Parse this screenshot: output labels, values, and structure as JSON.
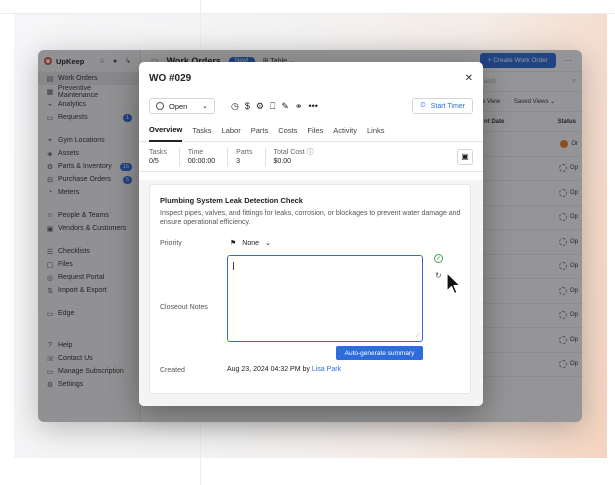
{
  "app": {
    "brand": "UpKeep",
    "sidebar": {
      "items": [
        {
          "label": "Work Orders",
          "icon": "clipboard-icon",
          "active": true
        },
        {
          "label": "Preventive Maintenance",
          "icon": "calendar-icon"
        },
        {
          "label": "Analytics",
          "icon": "chart-icon"
        },
        {
          "label": "Requests",
          "icon": "inbox-icon",
          "badge": "1"
        },
        {
          "label": "Gym Locations",
          "icon": "location-icon"
        },
        {
          "label": "Assets",
          "icon": "cube-icon"
        },
        {
          "label": "Parts & Inventory",
          "icon": "gear-icon",
          "badge": "16"
        },
        {
          "label": "Purchase Orders",
          "icon": "cart-icon",
          "badge": "5"
        },
        {
          "label": "Meters",
          "icon": "gauge-icon"
        },
        {
          "label": "People & Teams",
          "icon": "people-icon"
        },
        {
          "label": "Vendors & Customers",
          "icon": "store-icon"
        },
        {
          "label": "Checklists",
          "icon": "checklist-icon"
        },
        {
          "label": "Files",
          "icon": "file-icon"
        },
        {
          "label": "Request Portal",
          "icon": "globe-icon"
        },
        {
          "label": "Import & Export",
          "icon": "import-icon"
        },
        {
          "label": "Edge",
          "icon": "edge-icon"
        },
        {
          "label": "Help",
          "icon": "help-icon"
        },
        {
          "label": "Contact Us",
          "icon": "phone-icon"
        },
        {
          "label": "Manage Subscription",
          "icon": "card-icon"
        },
        {
          "label": "Settings",
          "icon": "settings-icon"
        }
      ]
    },
    "topbar": {
      "title": "Work Orders",
      "new_badge": "New!",
      "view": "Table",
      "create_label": "+ Create Work Order"
    },
    "right": {
      "search_placeholder": "arch",
      "views_label": "e View",
      "saved_views": "Saved Views",
      "col_date": "nt Date",
      "col_status": "Status",
      "rows": [
        "Or",
        "Op",
        "Op",
        "Op",
        "Op",
        "Op",
        "Op",
        "Op",
        "Op",
        "Op"
      ]
    }
  },
  "modal": {
    "title": "WO #029",
    "status": "Open",
    "timer_label": "Start Timer",
    "tabs": [
      "Overview",
      "Tasks",
      "Labor",
      "Parts",
      "Costs",
      "Files",
      "Activity",
      "Links"
    ],
    "active_tab": "Overview",
    "stats": {
      "tasks_label": "Tasks",
      "tasks_value": "0/5",
      "time_label": "Time",
      "time_value": "00:00:00",
      "parts_label": "Parts",
      "parts_value": "3",
      "cost_label": "Total Cost",
      "cost_value": "$0.00"
    },
    "wo_title": "Plumbing System Leak Detection Check",
    "wo_description": "Inspect pipes, valves, and fittings for leaks, corrosion, or blockages to prevent water damage and ensure operational efficiency.",
    "priority_label": "Priority",
    "priority_value": "None",
    "closeout_label": "Closeout Notes",
    "closeout_value": "",
    "auto_summary_label": "Auto-generate summary",
    "created_label": "Created",
    "created_value": "Aug 23, 2024 04:32 PM by",
    "created_by": "Lisa Park"
  },
  "colors": {
    "accent": "#2d6cdf",
    "success": "#3aa35c",
    "brand": "#e8553b"
  }
}
